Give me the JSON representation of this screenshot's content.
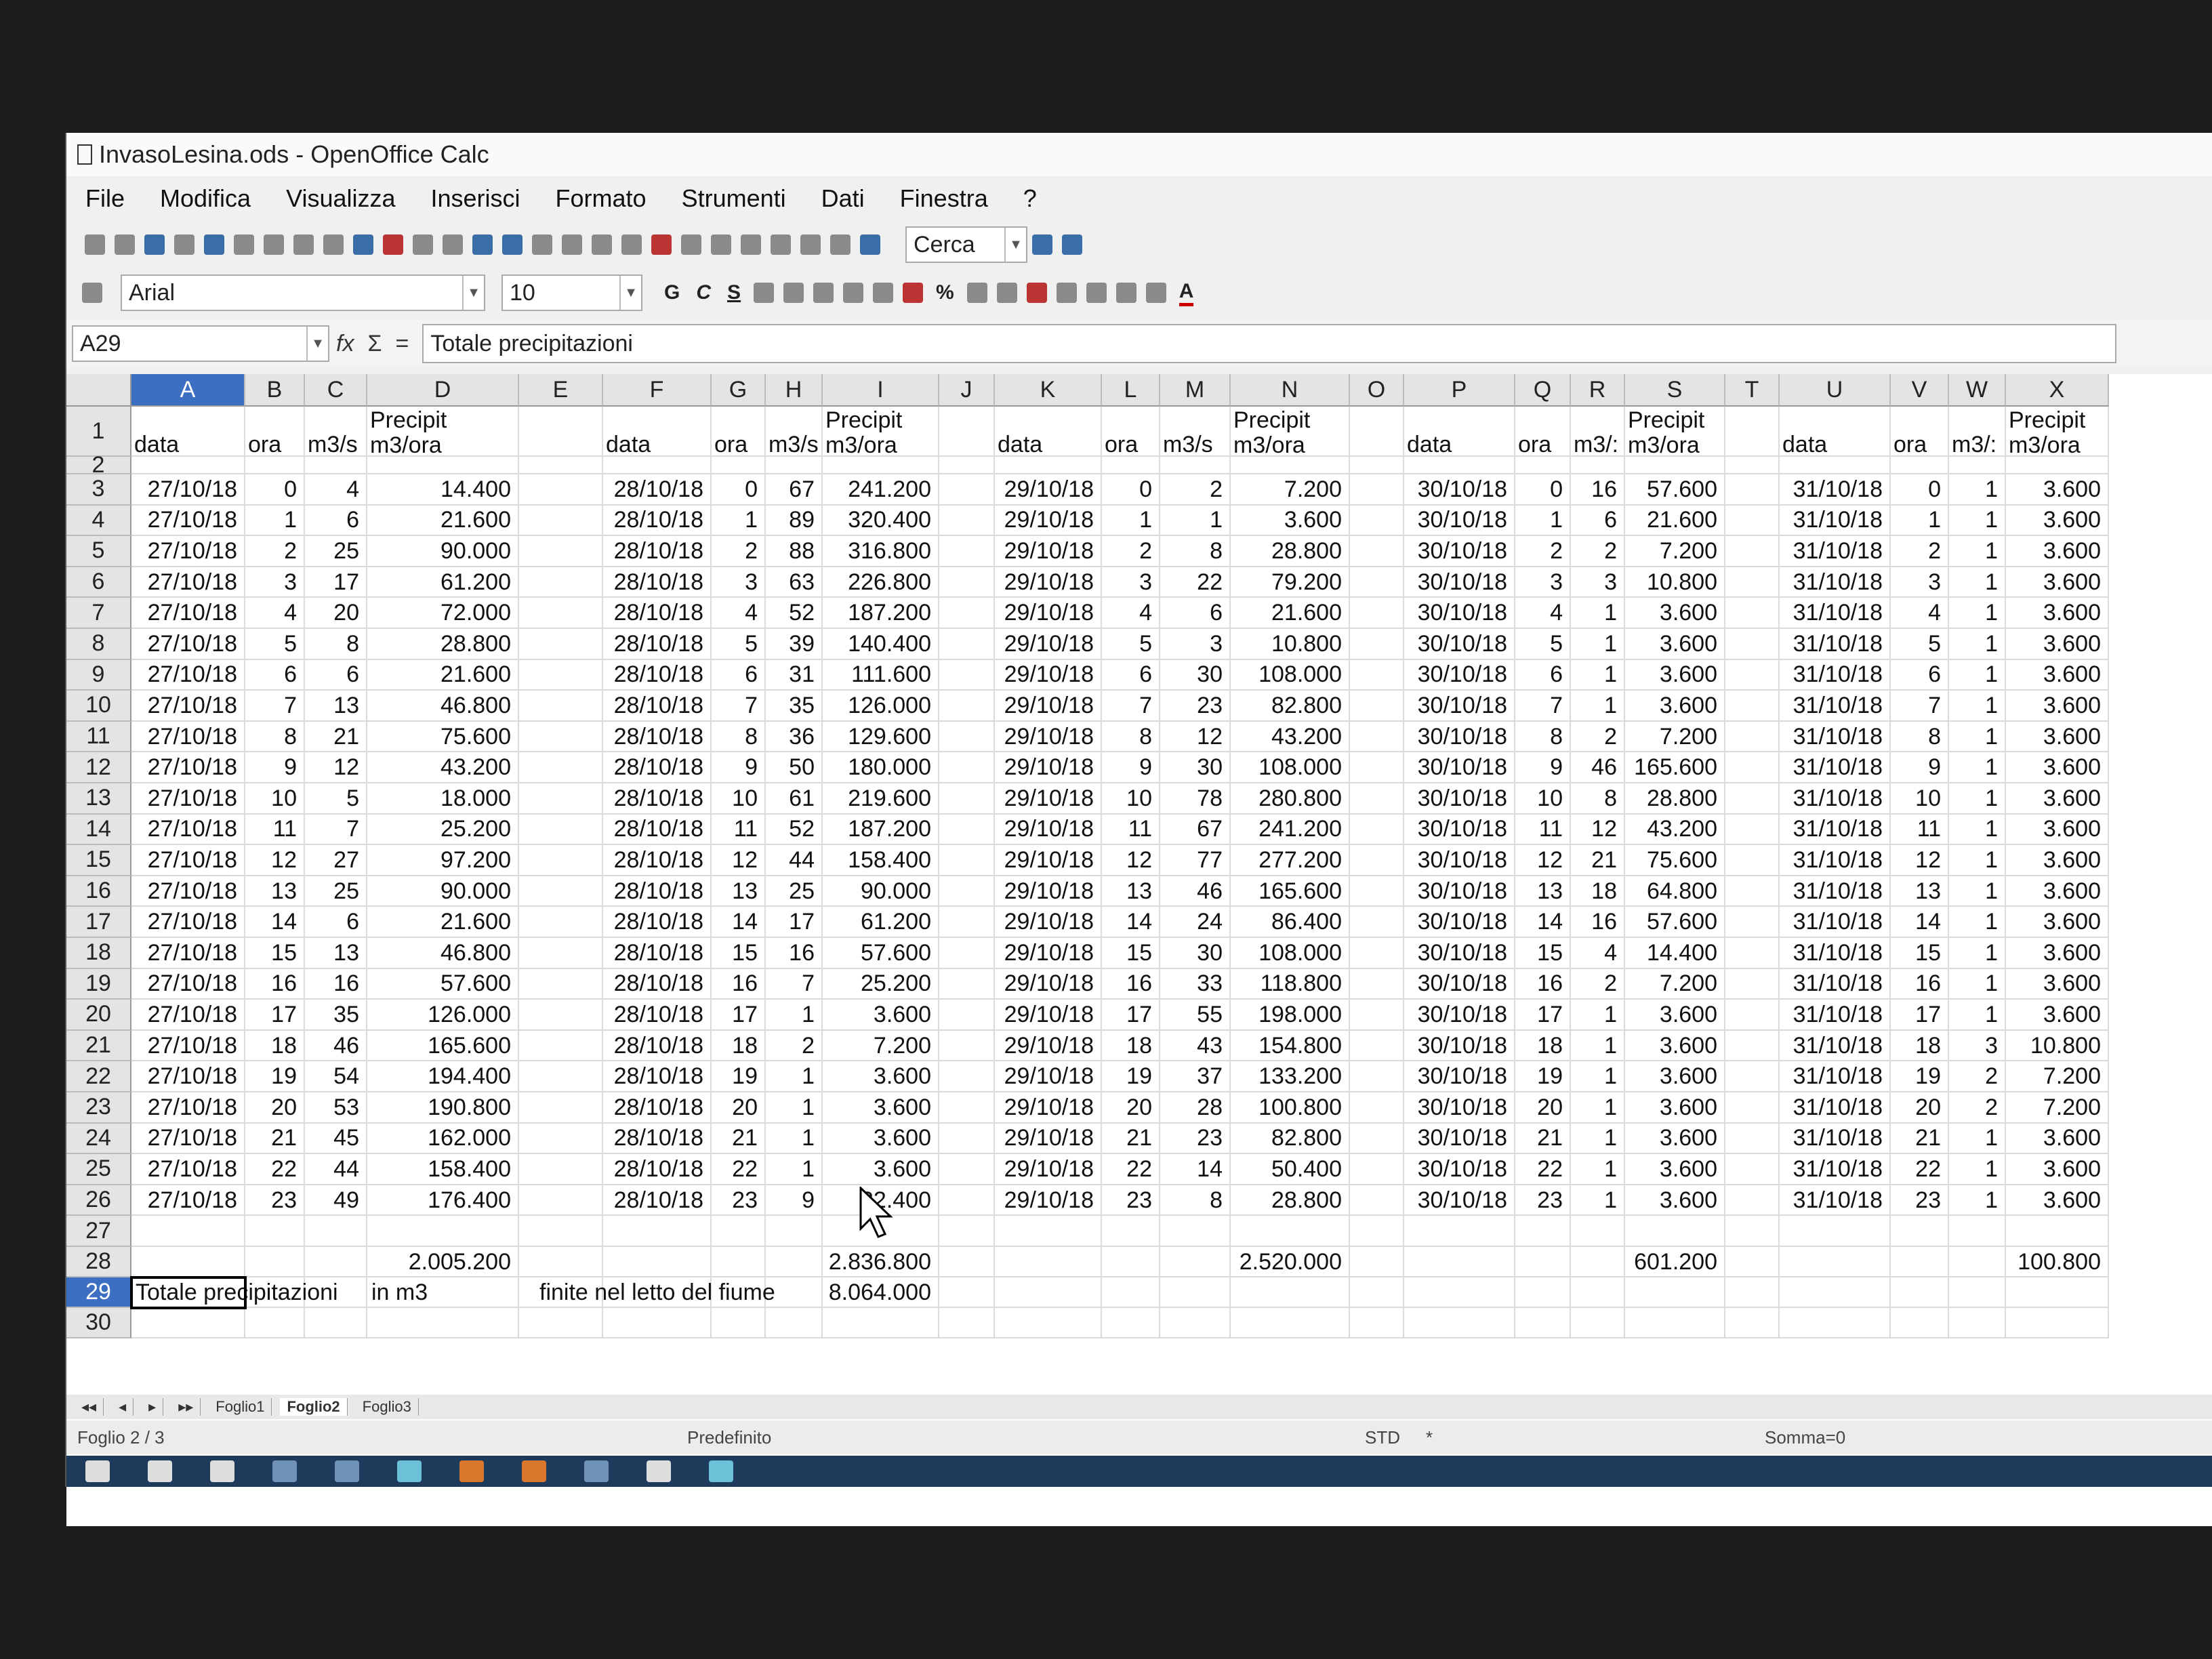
{
  "window": {
    "title": "InvasoLesina.ods - OpenOffice Calc"
  },
  "menu": [
    "File",
    "Modifica",
    "Visualizza",
    "Inserisci",
    "Formato",
    "Strumenti",
    "Dati",
    "Finestra",
    "?"
  ],
  "toolbar": {
    "search_placeholder": "Cerca",
    "font_name": "Arial",
    "font_size": "10"
  },
  "formula_bar": {
    "cell_ref": "A29",
    "content": "Totale precipitazioni"
  },
  "columns": [
    "A",
    "B",
    "C",
    "D",
    "E",
    "F",
    "G",
    "H",
    "I",
    "J",
    "K",
    "L",
    "M",
    "N",
    "O",
    "P",
    "Q",
    "R",
    "S",
    "T",
    "U",
    "V",
    "W",
    "X"
  ],
  "rows": [
    "1",
    "2",
    "3",
    "4",
    "5",
    "6",
    "7",
    "8",
    "9",
    "10",
    "11",
    "12",
    "13",
    "14",
    "15",
    "16",
    "17",
    "18",
    "19",
    "20",
    "21",
    "22",
    "23",
    "24",
    "25",
    "26",
    "27",
    "28",
    "29",
    "30"
  ],
  "selected": {
    "column": "A",
    "row": "29"
  },
  "headers": {
    "data": "data",
    "ora": "ora",
    "m3s": "m3/s",
    "m3s_trunc": "m3/:",
    "precipit": "Precipit\nm3/ora"
  },
  "blocks": [
    {
      "data": [
        "27/10/18",
        "27/10/18",
        "27/10/18",
        "27/10/18",
        "27/10/18",
        "27/10/18",
        "27/10/18",
        "27/10/18",
        "27/10/18",
        "27/10/18",
        "27/10/18",
        "27/10/18",
        "27/10/18",
        "27/10/18",
        "27/10/18",
        "27/10/18",
        "27/10/18",
        "27/10/18",
        "27/10/18",
        "27/10/18",
        "27/10/18",
        "27/10/18",
        "27/10/18",
        "27/10/18"
      ],
      "ora": [
        "0",
        "1",
        "2",
        "3",
        "4",
        "5",
        "6",
        "7",
        "8",
        "9",
        "10",
        "11",
        "12",
        "13",
        "14",
        "15",
        "16",
        "17",
        "18",
        "19",
        "20",
        "21",
        "22",
        "23"
      ],
      "m3s": [
        "4",
        "6",
        "25",
        "17",
        "20",
        "8",
        "6",
        "13",
        "21",
        "12",
        "5",
        "7",
        "27",
        "25",
        "6",
        "13",
        "16",
        "35",
        "46",
        "54",
        "53",
        "45",
        "44",
        "49"
      ],
      "precip": [
        "14.400",
        "21.600",
        "90.000",
        "61.200",
        "72.000",
        "28.800",
        "21.600",
        "46.800",
        "75.600",
        "43.200",
        "18.000",
        "25.200",
        "97.200",
        "90.000",
        "21.600",
        "46.800",
        "57.600",
        "126.000",
        "165.600",
        "194.400",
        "190.800",
        "162.000",
        "158.400",
        "176.400"
      ],
      "total": "2.005.200"
    },
    {
      "data": [
        "28/10/18",
        "28/10/18",
        "28/10/18",
        "28/10/18",
        "28/10/18",
        "28/10/18",
        "28/10/18",
        "28/10/18",
        "28/10/18",
        "28/10/18",
        "28/10/18",
        "28/10/18",
        "28/10/18",
        "28/10/18",
        "28/10/18",
        "28/10/18",
        "28/10/18",
        "28/10/18",
        "28/10/18",
        "28/10/18",
        "28/10/18",
        "28/10/18",
        "28/10/18",
        "28/10/18"
      ],
      "ora": [
        "0",
        "1",
        "2",
        "3",
        "4",
        "5",
        "6",
        "7",
        "8",
        "9",
        "10",
        "11",
        "12",
        "13",
        "14",
        "15",
        "16",
        "17",
        "18",
        "19",
        "20",
        "21",
        "22",
        "23"
      ],
      "m3s": [
        "67",
        "89",
        "88",
        "63",
        "52",
        "39",
        "31",
        "35",
        "36",
        "50",
        "61",
        "52",
        "44",
        "25",
        "17",
        "16",
        "7",
        "1",
        "2",
        "1",
        "1",
        "1",
        "1",
        "9"
      ],
      "precip": [
        "241.200",
        "320.400",
        "316.800",
        "226.800",
        "187.200",
        "140.400",
        "111.600",
        "126.000",
        "129.600",
        "180.000",
        "219.600",
        "187.200",
        "158.400",
        "90.000",
        "61.200",
        "57.600",
        "25.200",
        "3.600",
        "7.200",
        "3.600",
        "3.600",
        "3.600",
        "3.600",
        "32.400"
      ],
      "total": "2.836.800"
    },
    {
      "data": [
        "29/10/18",
        "29/10/18",
        "29/10/18",
        "29/10/18",
        "29/10/18",
        "29/10/18",
        "29/10/18",
        "29/10/18",
        "29/10/18",
        "29/10/18",
        "29/10/18",
        "29/10/18",
        "29/10/18",
        "29/10/18",
        "29/10/18",
        "29/10/18",
        "29/10/18",
        "29/10/18",
        "29/10/18",
        "29/10/18",
        "29/10/18",
        "29/10/18",
        "29/10/18",
        "29/10/18"
      ],
      "ora": [
        "0",
        "1",
        "2",
        "3",
        "4",
        "5",
        "6",
        "7",
        "8",
        "9",
        "10",
        "11",
        "12",
        "13",
        "14",
        "15",
        "16",
        "17",
        "18",
        "19",
        "20",
        "21",
        "22",
        "23"
      ],
      "m3s": [
        "2",
        "1",
        "8",
        "22",
        "6",
        "3",
        "30",
        "23",
        "12",
        "30",
        "78",
        "67",
        "77",
        "46",
        "24",
        "30",
        "33",
        "55",
        "43",
        "37",
        "28",
        "23",
        "14",
        "8"
      ],
      "precip": [
        "7.200",
        "3.600",
        "28.800",
        "79.200",
        "21.600",
        "10.800",
        "108.000",
        "82.800",
        "43.200",
        "108.000",
        "280.800",
        "241.200",
        "277.200",
        "165.600",
        "86.400",
        "108.000",
        "118.800",
        "198.000",
        "154.800",
        "133.200",
        "100.800",
        "82.800",
        "50.400",
        "28.800"
      ],
      "total": "2.520.000"
    },
    {
      "data": [
        "30/10/18",
        "30/10/18",
        "30/10/18",
        "30/10/18",
        "30/10/18",
        "30/10/18",
        "30/10/18",
        "30/10/18",
        "30/10/18",
        "30/10/18",
        "30/10/18",
        "30/10/18",
        "30/10/18",
        "30/10/18",
        "30/10/18",
        "30/10/18",
        "30/10/18",
        "30/10/18",
        "30/10/18",
        "30/10/18",
        "30/10/18",
        "30/10/18",
        "30/10/18",
        "30/10/18"
      ],
      "ora": [
        "0",
        "1",
        "2",
        "3",
        "4",
        "5",
        "6",
        "7",
        "8",
        "9",
        "10",
        "11",
        "12",
        "13",
        "14",
        "15",
        "16",
        "17",
        "18",
        "19",
        "20",
        "21",
        "22",
        "23"
      ],
      "m3s": [
        "16",
        "6",
        "2",
        "3",
        "1",
        "1",
        "1",
        "1",
        "2",
        "46",
        "8",
        "12",
        "21",
        "18",
        "16",
        "4",
        "2",
        "1",
        "1",
        "1",
        "1",
        "1",
        "1",
        "1"
      ],
      "precip": [
        "57.600",
        "21.600",
        "7.200",
        "10.800",
        "3.600",
        "3.600",
        "3.600",
        "3.600",
        "7.200",
        "165.600",
        "28.800",
        "43.200",
        "75.600",
        "64.800",
        "57.600",
        "14.400",
        "7.200",
        "3.600",
        "3.600",
        "3.600",
        "3.600",
        "3.600",
        "3.600",
        "3.600"
      ],
      "total": "601.200"
    },
    {
      "data": [
        "31/10/18",
        "31/10/18",
        "31/10/18",
        "31/10/18",
        "31/10/18",
        "31/10/18",
        "31/10/18",
        "31/10/18",
        "31/10/18",
        "31/10/18",
        "31/10/18",
        "31/10/18",
        "31/10/18",
        "31/10/18",
        "31/10/18",
        "31/10/18",
        "31/10/18",
        "31/10/18",
        "31/10/18",
        "31/10/18",
        "31/10/18",
        "31/10/18",
        "31/10/18",
        "31/10/18"
      ],
      "ora": [
        "0",
        "1",
        "2",
        "3",
        "4",
        "5",
        "6",
        "7",
        "8",
        "9",
        "10",
        "11",
        "12",
        "13",
        "14",
        "15",
        "16",
        "17",
        "18",
        "19",
        "20",
        "21",
        "22",
        "23"
      ],
      "m3s": [
        "1",
        "1",
        "1",
        "1",
        "1",
        "1",
        "1",
        "1",
        "1",
        "1",
        "1",
        "1",
        "1",
        "1",
        "1",
        "1",
        "1",
        "1",
        "3",
        "2",
        "2",
        "1",
        "1",
        "1"
      ],
      "precip": [
        "3.600",
        "3.600",
        "3.600",
        "3.600",
        "3.600",
        "3.600",
        "3.600",
        "3.600",
        "3.600",
        "3.600",
        "3.600",
        "3.600",
        "3.600",
        "3.600",
        "3.600",
        "3.600",
        "3.600",
        "3.600",
        "10.800",
        "7.200",
        "7.200",
        "3.600",
        "3.600",
        "3.600"
      ],
      "total": "100.800"
    }
  ],
  "row29": {
    "a": "Totale precipitazioni",
    "c": "in m3",
    "e": "finite nel letto del fiume",
    "i": "8.064.000"
  },
  "sheet_tabs": [
    "Foglio1",
    "Foglio2",
    "Foglio3"
  ],
  "status": {
    "sheet": "Foglio 2 / 3",
    "style": "Predefinito",
    "mode": "STD",
    "mode_mark": "*",
    "sum": "Somma=0"
  }
}
